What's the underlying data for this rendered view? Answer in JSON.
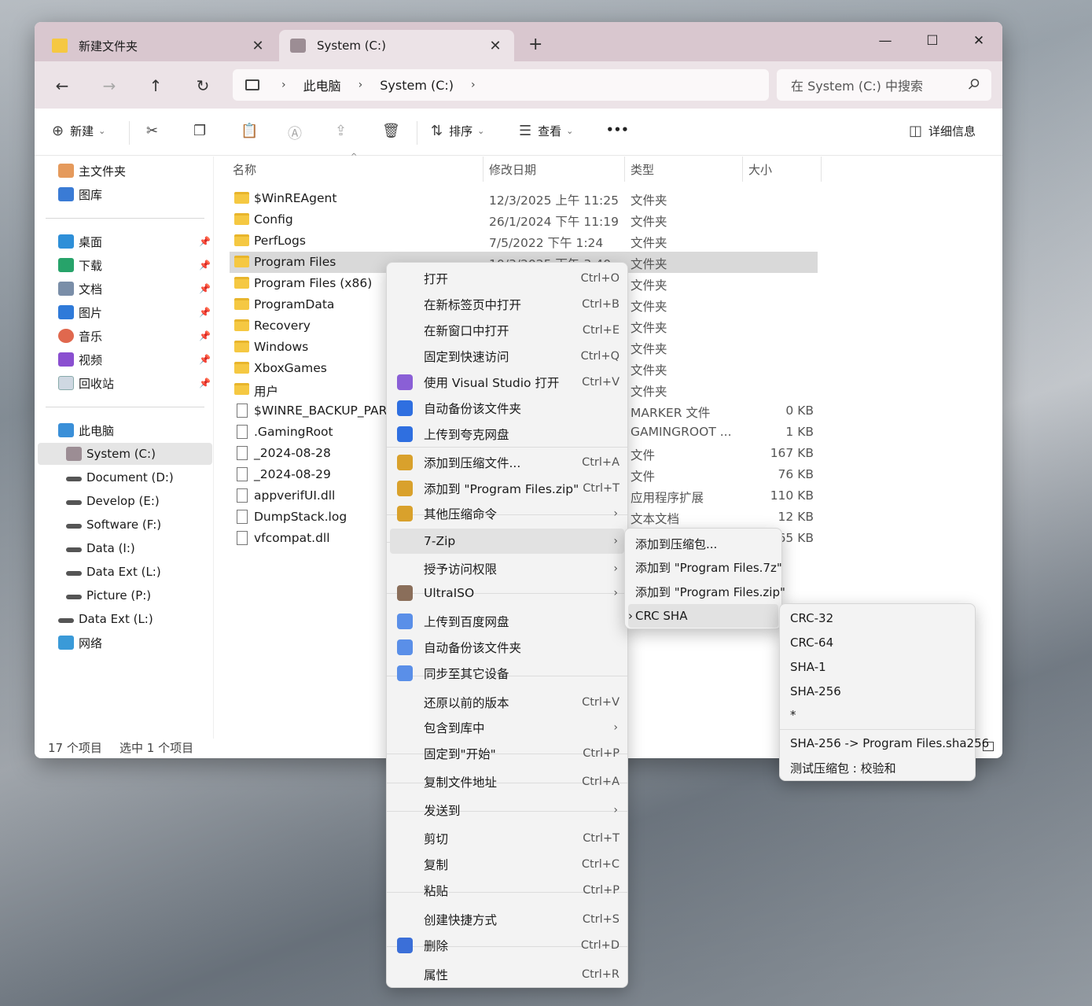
{
  "titlebar": {
    "tabs": [
      {
        "label": "新建文件夹",
        "close": "✕"
      },
      {
        "label": "System (C:)",
        "close": "✕"
      }
    ],
    "new_tab": "+",
    "controls": {
      "minimize": "—",
      "maximize": "☐",
      "close": "✕"
    }
  },
  "nav": {
    "back": "←",
    "forward": "→",
    "up": "↑",
    "refresh": "↻",
    "breadcrumb": [
      "此电脑",
      "System (C:)"
    ],
    "sep": "›",
    "search_placeholder": "在 System (C:) 中搜索"
  },
  "toolbar": {
    "new_label": "新建",
    "sort_label": "排序",
    "view_label": "查看",
    "more": "•••",
    "details_label": "详细信息"
  },
  "sidebar": {
    "top": [
      {
        "label": "主文件夹"
      },
      {
        "label": "图库"
      }
    ],
    "pinned": [
      {
        "label": "桌面"
      },
      {
        "label": "下载"
      },
      {
        "label": "文档"
      },
      {
        "label": "图片"
      },
      {
        "label": "音乐"
      },
      {
        "label": "视频"
      },
      {
        "label": "回收站"
      }
    ],
    "this_pc": "此电脑",
    "drives": [
      {
        "label": "System (C:)"
      },
      {
        "label": "Document (D:)"
      },
      {
        "label": "Develop (E:)"
      },
      {
        "label": "Software (F:)"
      },
      {
        "label": "Data (I:)"
      },
      {
        "label": "Data Ext (L:)"
      },
      {
        "label": "Picture (P:)"
      }
    ],
    "data_ext": "Data Ext (L:)",
    "network": "网络"
  },
  "columns": {
    "name": "名称",
    "date": "修改日期",
    "type": "类型",
    "size": "大小"
  },
  "files": [
    {
      "name": "$WinREAgent",
      "date": "12/3/2025 上午 11:25",
      "type": "文件夹",
      "size": "",
      "kind": "folder"
    },
    {
      "name": "Config",
      "date": "26/1/2024 下午 11:19",
      "type": "文件夹",
      "size": "",
      "kind": "folder"
    },
    {
      "name": "PerfLogs",
      "date": "7/5/2022 下午 1:24",
      "type": "文件夹",
      "size": "",
      "kind": "folder"
    },
    {
      "name": "Program Files",
      "date": "10/3/2025 下午 3:40",
      "type": "文件夹",
      "size": "",
      "kind": "folder"
    },
    {
      "name": "Program Files (x86)",
      "date": "",
      "type": "文件夹",
      "size": "",
      "kind": "folder"
    },
    {
      "name": "ProgramData",
      "date": "",
      "type": "文件夹",
      "size": "",
      "kind": "folder"
    },
    {
      "name": "Recovery",
      "date": "",
      "type": "文件夹",
      "size": "",
      "kind": "folder"
    },
    {
      "name": "Windows",
      "date": "",
      "type": "文件夹",
      "size": "",
      "kind": "folder"
    },
    {
      "name": "XboxGames",
      "date": "",
      "type": "文件夹",
      "size": "",
      "kind": "folder"
    },
    {
      "name": "用户",
      "date": "",
      "type": "文件夹",
      "size": "",
      "kind": "folder"
    },
    {
      "name": "$WINRE_BACKUP_PART",
      "date": "",
      "type": "MARKER 文件",
      "size": "0 KB",
      "kind": "file"
    },
    {
      "name": ".GamingRoot",
      "date": "",
      "type": "GAMINGROOT ...",
      "size": "1 KB",
      "kind": "file"
    },
    {
      "name": "_2024-08-28",
      "date": "",
      "type": "文件",
      "size": "167 KB",
      "kind": "file"
    },
    {
      "name": "_2024-08-29",
      "date": "",
      "type": "文件",
      "size": "76 KB",
      "kind": "file"
    },
    {
      "name": "appverifUI.dll",
      "date": "",
      "type": "应用程序扩展",
      "size": "110 KB",
      "kind": "file"
    },
    {
      "name": "DumpStack.log",
      "date": "",
      "type": "文本文档",
      "size": "12 KB",
      "kind": "file"
    },
    {
      "name": "vfcompat.dll",
      "date": "",
      "type": "",
      "size": "65 KB",
      "kind": "file"
    }
  ],
  "status": {
    "count": "17 个项目",
    "selected": "选中 1 个项目"
  },
  "context_menu": [
    {
      "label": "打开",
      "shortcut": "Ctrl+O"
    },
    {
      "label": "在新标签页中打开",
      "shortcut": "Ctrl+B"
    },
    {
      "label": "在新窗口中打开",
      "shortcut": "Ctrl+E"
    },
    {
      "label": "固定到快速访问",
      "shortcut": "Ctrl+Q"
    },
    {
      "label": "使用 Visual Studio 打开",
      "shortcut": "Ctrl+V"
    },
    {
      "label": "自动备份该文件夹",
      "shortcut": ""
    },
    {
      "label": "上传到夸克网盘",
      "shortcut": ""
    },
    {
      "label": "添加到压缩文件...",
      "shortcut": "Ctrl+A"
    },
    {
      "label": "添加到 \"Program Files.zip\"",
      "shortcut": "Ctrl+T"
    },
    {
      "label": "其他压缩命令",
      "shortcut": "›"
    },
    {
      "label": "7-Zip",
      "shortcut": "›"
    },
    {
      "label": "授予访问权限",
      "shortcut": "›"
    },
    {
      "label": "UltraISO",
      "shortcut": "›"
    },
    {
      "label": "上传到百度网盘",
      "shortcut": ""
    },
    {
      "label": "自动备份该文件夹",
      "shortcut": ""
    },
    {
      "label": "同步至其它设备",
      "shortcut": ""
    },
    {
      "label": "还原以前的版本",
      "shortcut": "Ctrl+V"
    },
    {
      "label": "包含到库中",
      "shortcut": "›"
    },
    {
      "label": "固定到\"开始\"",
      "shortcut": "Ctrl+P"
    },
    {
      "label": "复制文件地址",
      "shortcut": "Ctrl+A"
    },
    {
      "label": "发送到",
      "shortcut": "›"
    },
    {
      "label": "剪切",
      "shortcut": "Ctrl+T"
    },
    {
      "label": "复制",
      "shortcut": "Ctrl+C"
    },
    {
      "label": "粘贴",
      "shortcut": "Ctrl+P"
    },
    {
      "label": "创建快捷方式",
      "shortcut": "Ctrl+S"
    },
    {
      "label": "删除",
      "shortcut": "Ctrl+D"
    },
    {
      "label": "属性",
      "shortcut": "Ctrl+R"
    }
  ],
  "zip_submenu": [
    {
      "label": "添加到压缩包..."
    },
    {
      "label": "添加到 \"Program Files.7z\""
    },
    {
      "label": "添加到 \"Program Files.zip\""
    },
    {
      "label": "CRC SHA",
      "arrow": "›"
    }
  ],
  "crc_submenu": [
    {
      "label": "CRC-32"
    },
    {
      "label": "CRC-64"
    },
    {
      "label": "SHA-1"
    },
    {
      "label": "SHA-256"
    },
    {
      "label": "*"
    },
    {
      "label": "SHA-256 -> Program Files.sha256"
    },
    {
      "label": "测试压缩包 : 校验和"
    }
  ],
  "colors": {
    "folder": "#f5c842",
    "selection": "#d9d9d9",
    "titlebar": "#d9c7cf"
  }
}
